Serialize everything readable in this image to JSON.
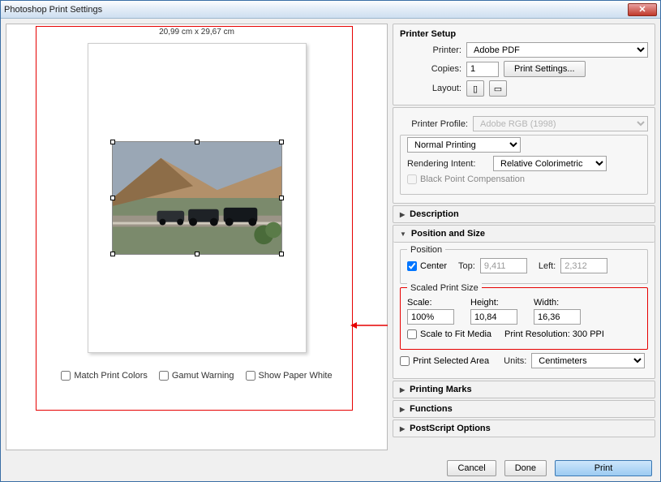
{
  "title": "Photoshop Print Settings",
  "preview": {
    "dims": "20,99 cm x 29,67 cm"
  },
  "underChecks": {
    "matchPrintColors": "Match Print Colors",
    "gamutWarning": "Gamut Warning",
    "showPaperWhite": "Show Paper White"
  },
  "printerSetup": {
    "title": "Printer Setup",
    "printerLabel": "Printer:",
    "printer": "Adobe PDF",
    "copiesLabel": "Copies:",
    "copies": "1",
    "printSettingsBtn": "Print Settings...",
    "layoutLabel": "Layout:"
  },
  "colorMgmt": {
    "profileLabel": "Printer Profile:",
    "profile": "Adobe RGB (1998)",
    "mode": "Normal Printing",
    "intentLabel": "Rendering Intent:",
    "intent": "Relative Colorimetric",
    "blackPoint": "Black Point Compensation"
  },
  "sections": {
    "description": "Description",
    "positionSize": "Position and Size",
    "printingMarks": "Printing Marks",
    "functions": "Functions",
    "postscript": "PostScript Options"
  },
  "position": {
    "legend": "Position",
    "centerLabel": "Center",
    "topLabel": "Top:",
    "top": "9,411",
    "leftLabel": "Left:",
    "left": "2,312"
  },
  "scaledPrintSize": {
    "legend": "Scaled Print Size",
    "scaleLabel": "Scale:",
    "scale": "100%",
    "heightLabel": "Height:",
    "height": "10,84",
    "widthLabel": "Width:",
    "width": "16,36",
    "scaleToFit": "Scale to Fit Media",
    "resolution": "Print Resolution: 300 PPI"
  },
  "printArea": {
    "printSelected": "Print Selected Area",
    "unitsLabel": "Units:",
    "units": "Centimeters"
  },
  "footer": {
    "cancel": "Cancel",
    "done": "Done",
    "print": "Print"
  }
}
